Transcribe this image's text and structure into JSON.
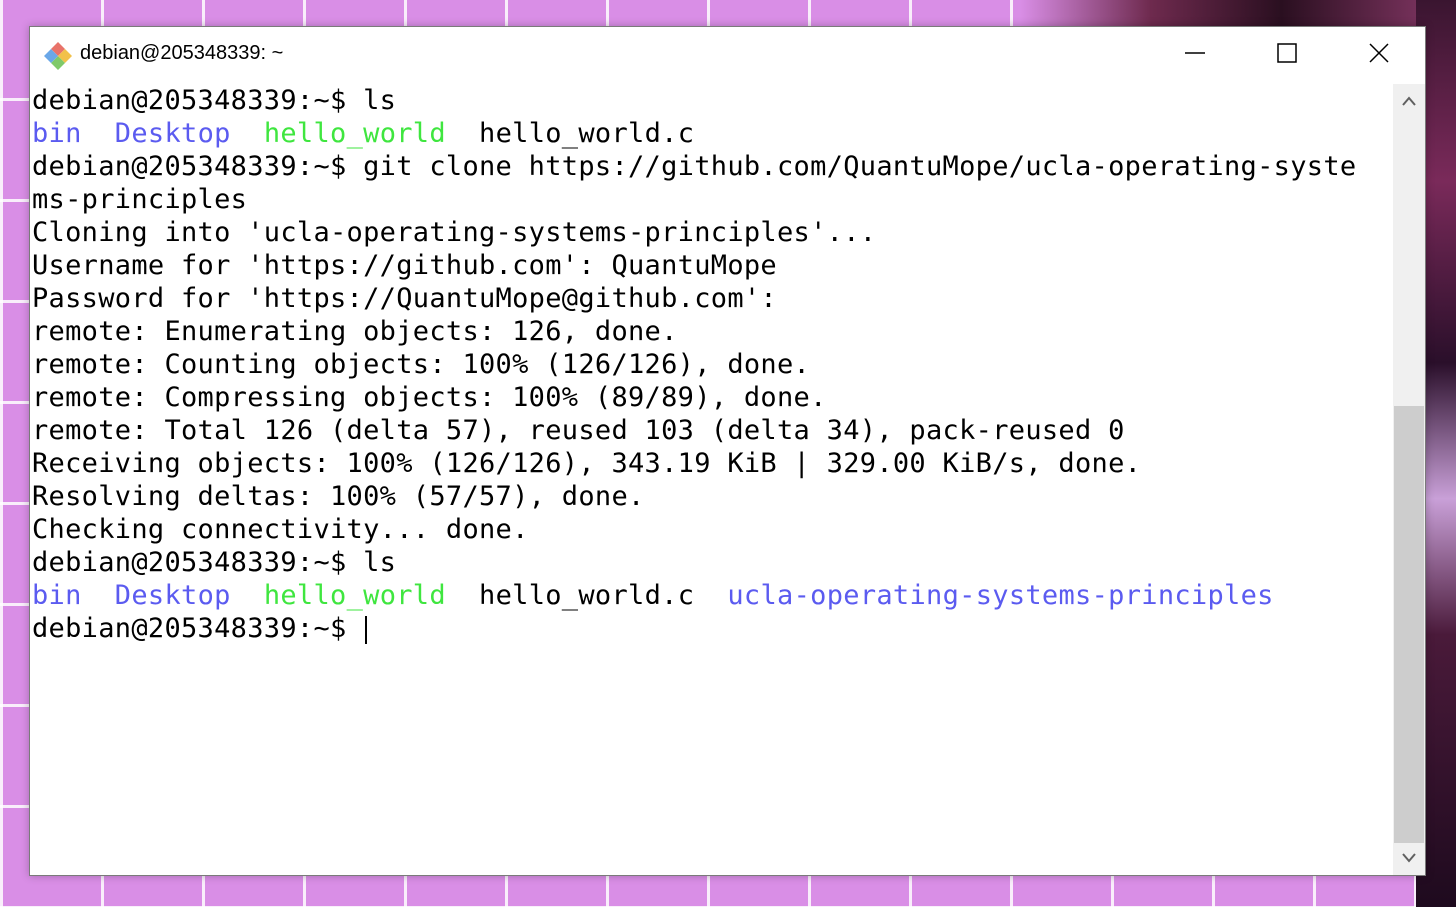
{
  "window": {
    "title": "debian@205348339: ~",
    "controls": {
      "minimize": "minimize",
      "maximize": "maximize",
      "close": "close"
    }
  },
  "colors": {
    "directory": "#5b5bf0",
    "executable": "#3fe63f",
    "text": "#000000",
    "background": "#ffffff"
  },
  "terminal": {
    "lines": [
      [
        {
          "t": "debian@205348339:~$ ls",
          "c": "black"
        }
      ],
      [
        {
          "t": "bin",
          "c": "blue"
        },
        {
          "t": "  ",
          "c": "black"
        },
        {
          "t": "Desktop",
          "c": "blue"
        },
        {
          "t": "  ",
          "c": "black"
        },
        {
          "t": "hello_world",
          "c": "green"
        },
        {
          "t": "  hello_world.c",
          "c": "black"
        }
      ],
      [
        {
          "t": "debian@205348339:~$ git clone https://github.com/QuantuMope/ucla-operating-syste",
          "c": "black"
        }
      ],
      [
        {
          "t": "ms-principles",
          "c": "black"
        }
      ],
      [
        {
          "t": "Cloning into 'ucla-operating-systems-principles'...",
          "c": "black"
        }
      ],
      [
        {
          "t": "Username for 'https://github.com': QuantuMope",
          "c": "black"
        }
      ],
      [
        {
          "t": "Password for 'https://QuantuMope@github.com':",
          "c": "black"
        }
      ],
      [
        {
          "t": "remote: Enumerating objects: 126, done.",
          "c": "black"
        }
      ],
      [
        {
          "t": "remote: Counting objects: 100% (126/126), done.",
          "c": "black"
        }
      ],
      [
        {
          "t": "remote: Compressing objects: 100% (89/89), done.",
          "c": "black"
        }
      ],
      [
        {
          "t": "remote: Total 126 (delta 57), reused 103 (delta 34), pack-reused 0",
          "c": "black"
        }
      ],
      [
        {
          "t": "Receiving objects: 100% (126/126), 343.19 KiB | 329.00 KiB/s, done.",
          "c": "black"
        }
      ],
      [
        {
          "t": "Resolving deltas: 100% (57/57), done.",
          "c": "black"
        }
      ],
      [
        {
          "t": "Checking connectivity... done.",
          "c": "black"
        }
      ],
      [
        {
          "t": "debian@205348339:~$ ls",
          "c": "black"
        }
      ],
      [
        {
          "t": "bin",
          "c": "blue"
        },
        {
          "t": "  ",
          "c": "black"
        },
        {
          "t": "Desktop",
          "c": "blue"
        },
        {
          "t": "  ",
          "c": "black"
        },
        {
          "t": "hello_world",
          "c": "green"
        },
        {
          "t": "  hello_world.c  ",
          "c": "black"
        },
        {
          "t": "ucla-operating-systems-principles",
          "c": "blue"
        }
      ],
      [
        {
          "t": "debian@205348339:~$ ",
          "c": "black"
        }
      ]
    ],
    "cursor_line": 16
  }
}
